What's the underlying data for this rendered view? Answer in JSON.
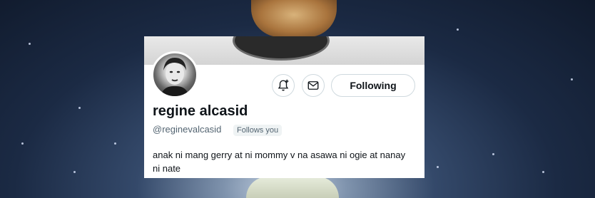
{
  "profile": {
    "display_name": "regine alcasid",
    "handle": "@reginevalcasid",
    "follows_you_badge": "Follows you",
    "bio": "anak ni mang gerry at ni mommy v na asawa ni ogie at nanay ni nate"
  },
  "actions": {
    "notify_icon": "bell-plus-icon",
    "message_icon": "mail-icon",
    "following_label": "Following"
  },
  "colors": {
    "text_primary": "#0f1419",
    "text_secondary": "#536471",
    "border": "#cfd9de"
  }
}
